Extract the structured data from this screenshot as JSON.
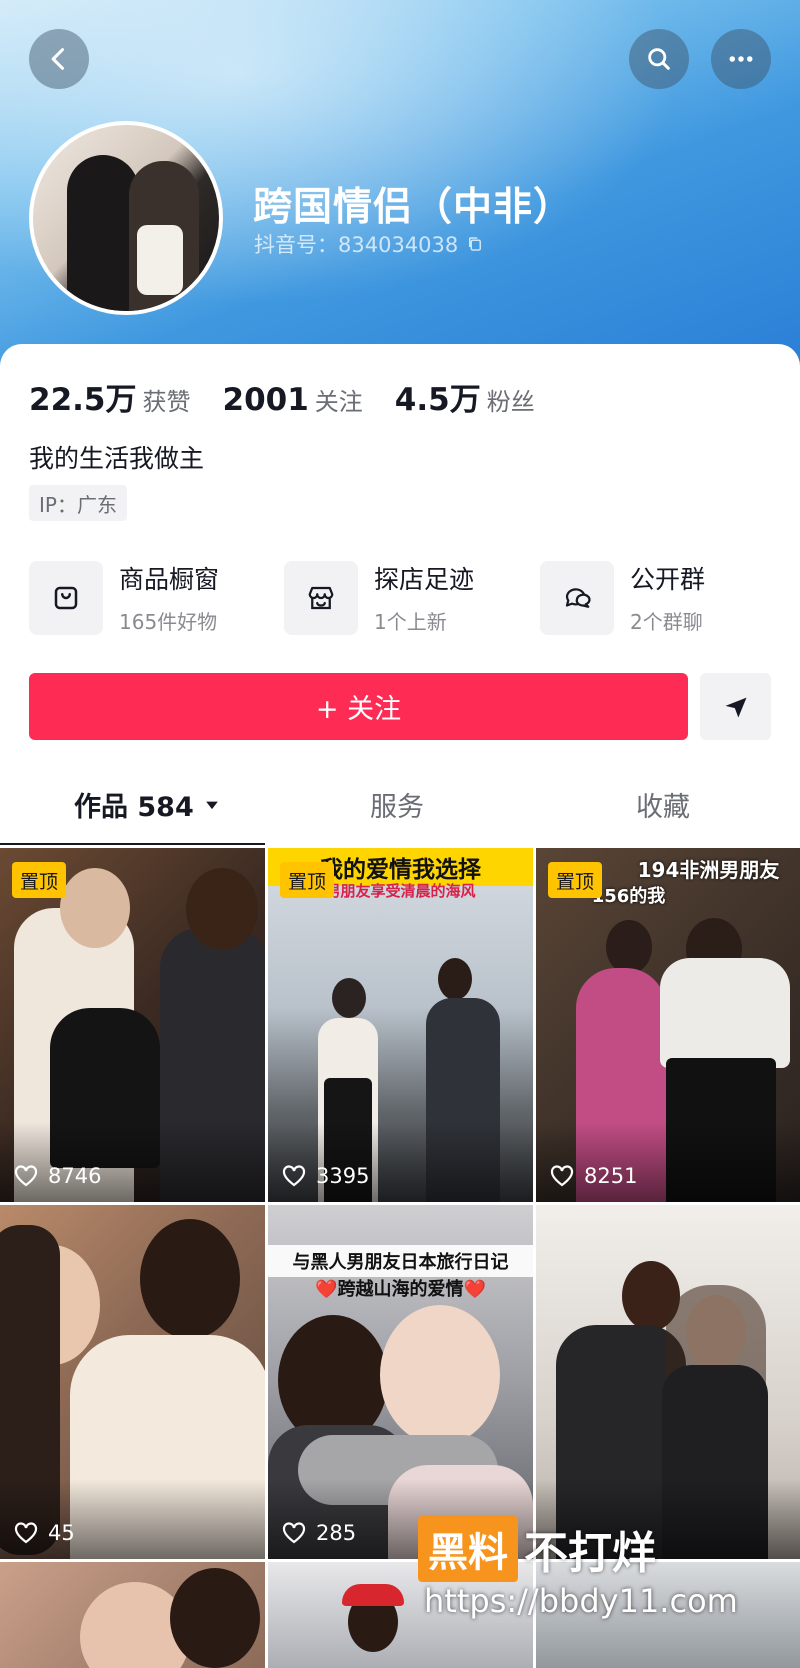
{
  "profile": {
    "name": "跨国情侣（中非）",
    "douyin_id": "抖音号：834034038"
  },
  "stats": [
    {
      "value": "22.5万",
      "label": "获赞"
    },
    {
      "value": "2001",
      "label": "关注"
    },
    {
      "value": "4.5万",
      "label": "粉丝"
    }
  ],
  "bio": "我的生活我做主",
  "ip": "IP：广东",
  "services": [
    {
      "title": "商品橱窗",
      "sub": "165件好物",
      "icon": "shopping-bag-icon"
    },
    {
      "title": "探店足迹",
      "sub": "1个上新",
      "icon": "store-icon"
    },
    {
      "title": "公开群",
      "sub": "2个群聊",
      "icon": "chat-bubbles-icon"
    }
  ],
  "follow_label": "+ 关注",
  "tabs": {
    "works": "作品 584",
    "service": "服务",
    "favorites": "收藏"
  },
  "videos": [
    {
      "likes": "8746",
      "pinned": "置顶",
      "caption": ""
    },
    {
      "likes": "3395",
      "pinned": "置顶",
      "caption": "我的爱情我选择",
      "subcaption": "男朋友享受清晨的海风"
    },
    {
      "likes": "8251",
      "pinned": "置顶",
      "caption": "194非洲男朋友",
      "subcaption": "156的我"
    },
    {
      "likes": "45",
      "pinned": "",
      "caption": ""
    },
    {
      "likes": "285",
      "pinned": "",
      "caption": "与黑人男朋友日本旅行日记",
      "subcaption": "❤️跨越山海的爱情❤️"
    },
    {
      "likes": "",
      "pinned": "",
      "caption": ""
    }
  ],
  "watermark": {
    "box": "黑料",
    "text": "不打烊",
    "url": "https://bbdy11.com"
  },
  "colors": {
    "accent": "#fe2c55",
    "pin": "#ffc300",
    "header": "#3f98df"
  }
}
